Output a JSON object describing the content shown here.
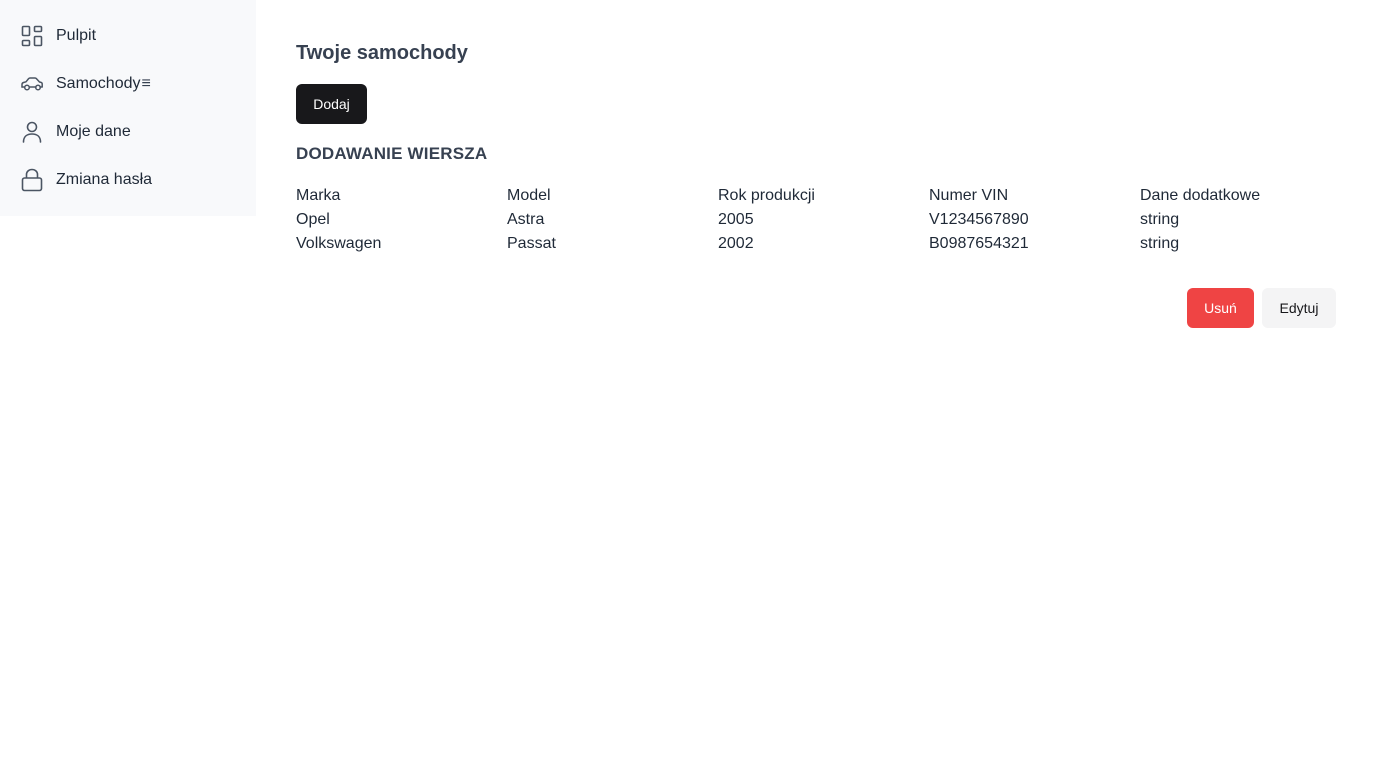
{
  "sidebar": {
    "items": [
      {
        "label": "Pulpit",
        "icon": "dashboard-icon"
      },
      {
        "label": "Samochody",
        "icon": "car-icon",
        "suffix_icon": "menu-icon",
        "suffix_glyph": "≡"
      },
      {
        "label": "Moje dane",
        "icon": "user-icon"
      },
      {
        "label": "Zmiana hasła",
        "icon": "lock-icon"
      }
    ]
  },
  "main": {
    "title": "Twoje samochody",
    "add_button": "Dodaj",
    "section_title": "DODAWANIE WIERSZA",
    "table": {
      "headers": [
        "Marka",
        "Model",
        "Rok produkcji",
        "Numer VIN",
        "Dane dodatkowe"
      ],
      "rows": [
        [
          "Opel",
          "Astra",
          "2005",
          "V1234567890",
          "string"
        ],
        [
          "Volkswagen",
          "Passat",
          "2002",
          "B0987654321",
          "string"
        ]
      ]
    },
    "delete_button": "Usuń",
    "edit_button": "Edytuj"
  },
  "colors": {
    "sidebar_bg": "#f8f9fb",
    "primary_button": "#18181b",
    "danger_button": "#ef4444",
    "secondary_button": "#f4f4f5"
  }
}
